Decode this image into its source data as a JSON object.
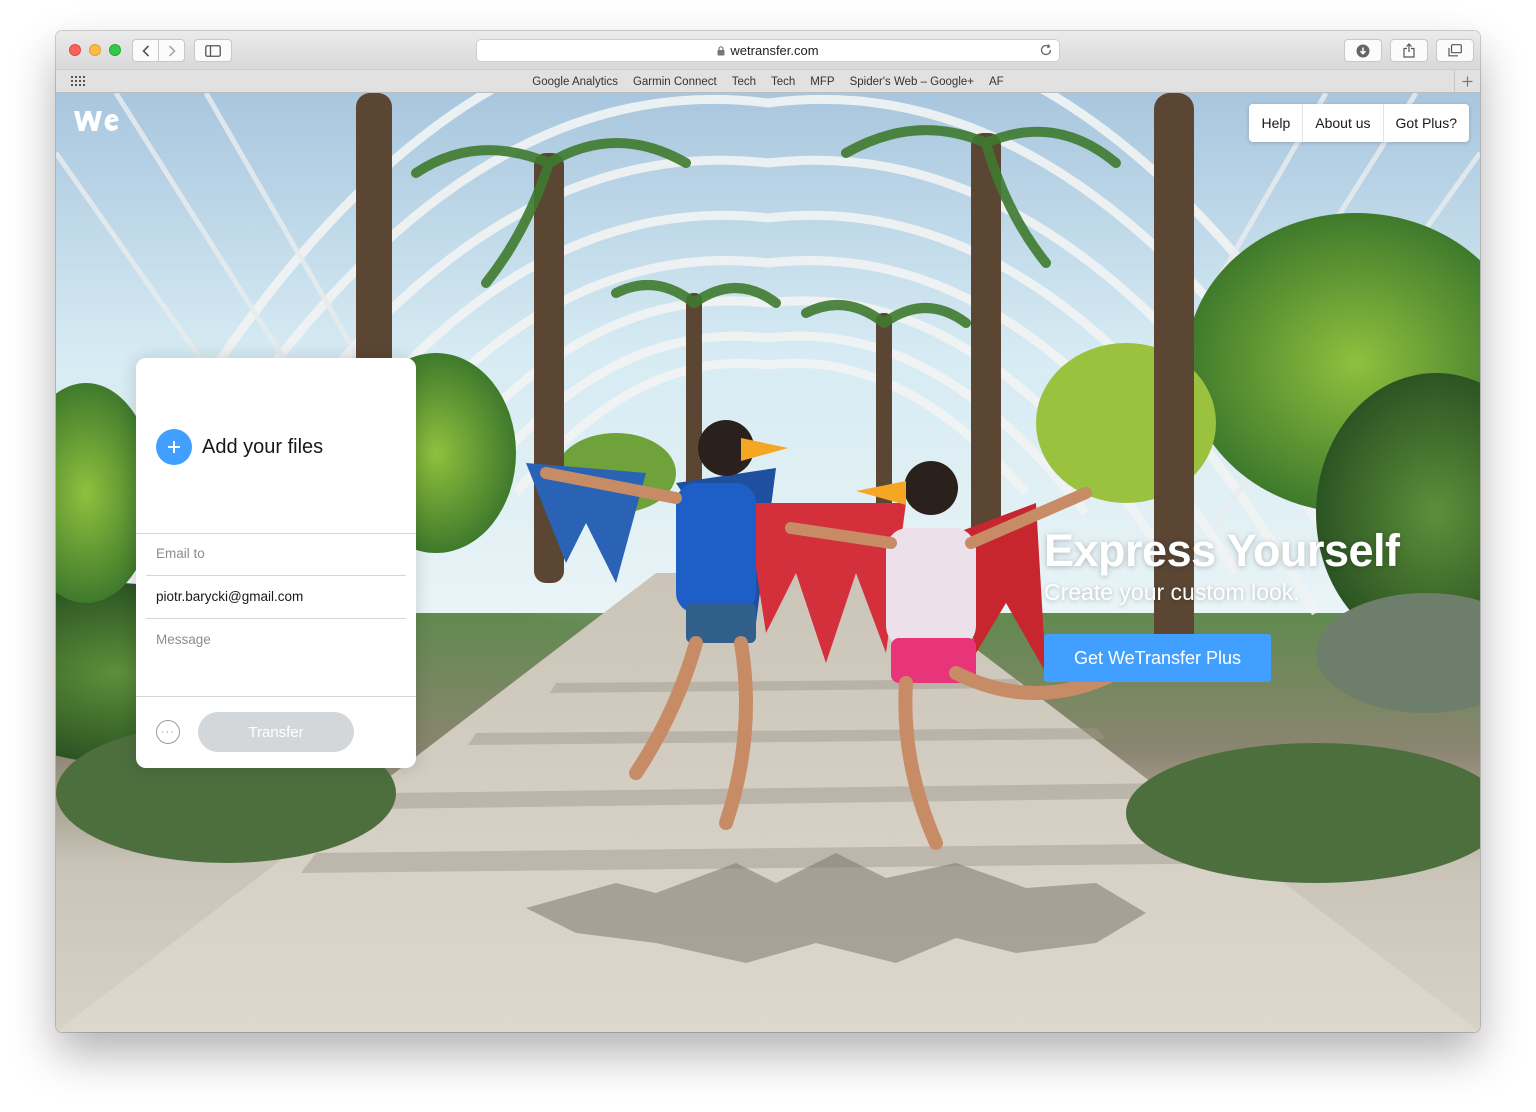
{
  "browser": {
    "url": "wetransfer.com",
    "favorites": [
      "Google Analytics",
      "Garmin Connect",
      "Tech",
      "Tech",
      "MFP",
      "Spider's Web – Google+",
      "AF"
    ]
  },
  "nav": {
    "help": "Help",
    "about": "About us",
    "plus": "Got Plus?"
  },
  "uploader": {
    "add_files": "Add your files",
    "email_to_placeholder": "Email to",
    "your_email": "piotr.barycki@gmail.com",
    "message_placeholder": "Message",
    "transfer_label": "Transfer",
    "more_label": "···"
  },
  "promo": {
    "title": "Express Yourself",
    "subtitle": "Create your custom look.",
    "cta": "Get WeTransfer Plus"
  },
  "colors": {
    "accent": "#409fff",
    "disabled": "#d4d7d9",
    "text": "#17181a",
    "muted": "#8b8d90"
  },
  "icons": [
    "wetransfer-logo-icon",
    "plus-icon",
    "more-options-icon",
    "lock-icon",
    "reload-icon",
    "download-icon",
    "share-icon",
    "tabs-icon"
  ]
}
